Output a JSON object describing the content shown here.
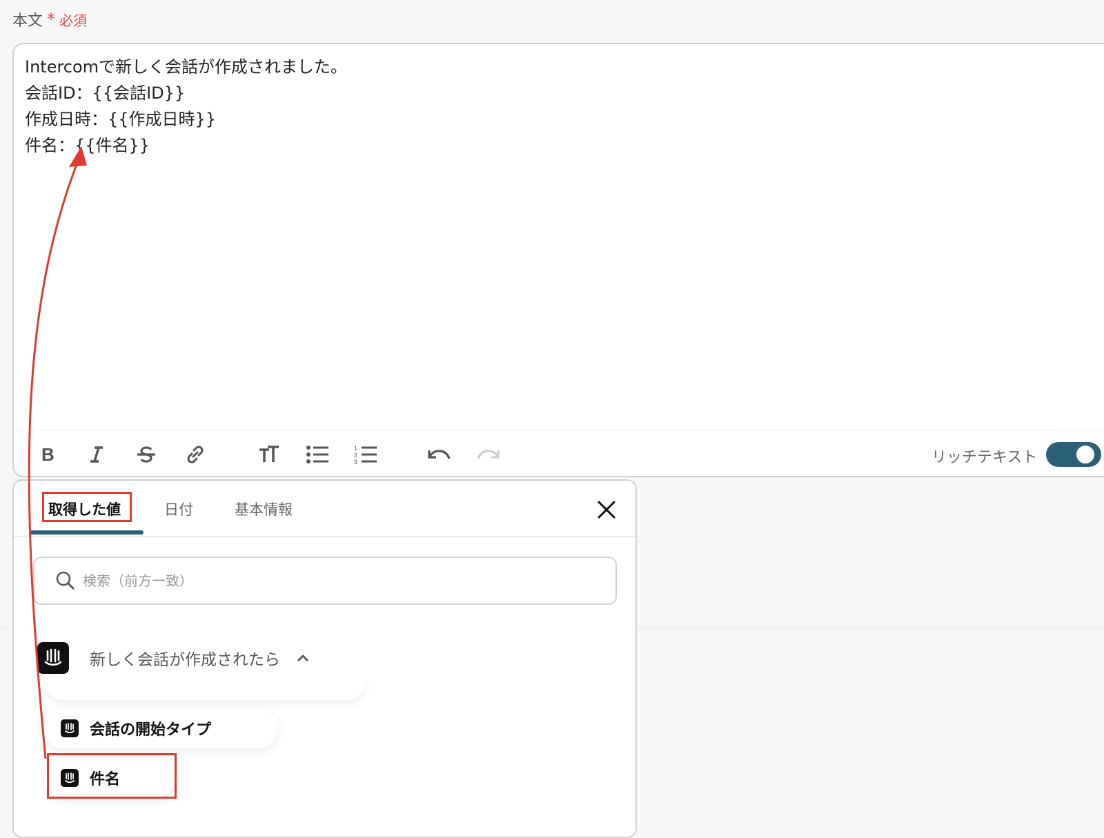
{
  "field": {
    "label": "本文",
    "required_star": "*",
    "required_text": "必須"
  },
  "editor": {
    "body": "Intercomで新しく会話が作成されました。\n会話ID：{{会話ID}}\n作成日時：{{作成日時}}\n件名：{{件名}}",
    "toolbar": {
      "buttons": [
        "bold-icon",
        "italic-icon",
        "strikethrough-icon",
        "link-icon",
        "text-size-icon",
        "bullet-list-icon",
        "numbered-list-icon",
        "undo-icon",
        "redo-icon"
      ],
      "rich_text_label": "リッチテキスト",
      "rich_text_enabled": true
    }
  },
  "panel": {
    "tabs": [
      {
        "label": "取得した値",
        "active": true
      },
      {
        "label": "日付",
        "active": false
      },
      {
        "label": "基本情報",
        "active": false
      }
    ],
    "search": {
      "placeholder": "検索（前方一致）",
      "value": ""
    },
    "group": {
      "label": "新しく会話が作成されたら",
      "expanded": true
    },
    "items": [
      {
        "label": "会話の開始タイプ"
      },
      {
        "label": "件名"
      }
    ]
  },
  "colors": {
    "accent": "#2c6079",
    "highlight": "#e03a2f",
    "required": "#e5484d"
  }
}
